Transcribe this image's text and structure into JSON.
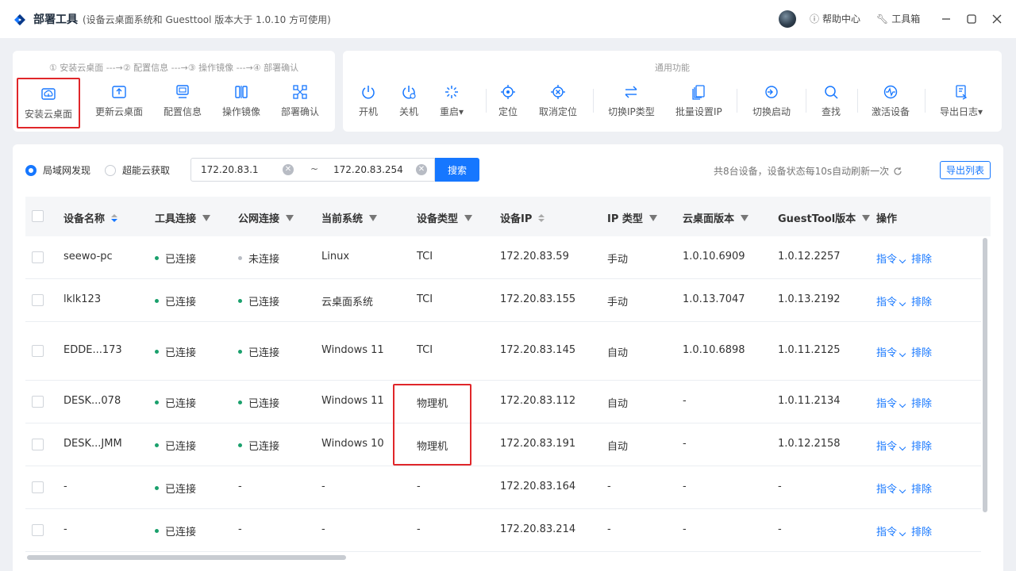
{
  "app": {
    "title": "部署工具",
    "subtitle": "(设备云桌面系统和 Guesttool 版本大于 1.0.10 方可使用)",
    "help_label": "帮助中心",
    "toolbox_label": "工具箱"
  },
  "steps": {
    "header": "① 安装云桌面 ---→② 配置信息 ---→③ 操作镜像 ---→④ 部署确认",
    "tools": [
      {
        "label": "安装云桌面",
        "icon": "cloud-upload-icon"
      },
      {
        "label": "更新云桌面",
        "icon": "upload-box-icon"
      },
      {
        "label": "配置信息",
        "icon": "monitor-config-icon"
      },
      {
        "label": "操作镜像",
        "icon": "mirror-icon"
      },
      {
        "label": "部署确认",
        "icon": "network-nodes-icon"
      }
    ]
  },
  "common": {
    "header": "通用功能",
    "tools": [
      {
        "label": "开机",
        "icon": "power-icon"
      },
      {
        "label": "关机",
        "icon": "power-off-icon"
      },
      {
        "label": "重启▾",
        "icon": "restart-icon"
      },
      {
        "label": "定位",
        "icon": "locate-icon"
      },
      {
        "label": "取消定位",
        "icon": "cancel-locate-icon"
      },
      {
        "label": "切换IP类型",
        "icon": "switch-arrows-icon"
      },
      {
        "label": "批量设置IP",
        "icon": "batch-ip-icon"
      },
      {
        "label": "切换启动",
        "icon": "switch-boot-icon"
      },
      {
        "label": "查找",
        "icon": "search-icon"
      },
      {
        "label": "激活设备",
        "icon": "activate-icon"
      },
      {
        "label": "导出日志▾",
        "icon": "export-log-icon"
      }
    ]
  },
  "filters": {
    "radio_lan": "局域网发现",
    "radio_cloud": "超能云获取",
    "ip_start": "172.20.83.1",
    "ip_sep": "~",
    "ip_end": "172.20.83.254",
    "search_label": "搜索",
    "summary": "共8台设备，设备状态每10s自动刷新一次",
    "export_list": "导出列表"
  },
  "table": {
    "headers": [
      "设备名称",
      "工具连接",
      "公网连接",
      "当前系统",
      "设备类型",
      "设备IP",
      "IP 类型",
      "云桌面版本",
      "GuestTool版本",
      "操作"
    ],
    "action_cmd": "指令",
    "action_remove": "排除",
    "rows": [
      {
        "name": "seewo-pc",
        "tool": "已连接",
        "tool_on": true,
        "net": "未连接",
        "net_on": false,
        "os": "Linux",
        "type": "TCI",
        "ip": "172.20.83.59",
        "iptype": "手动",
        "cloud_ver": "1.0.10.6909",
        "guest_ver": "1.0.12.2257"
      },
      {
        "name": "lklk123",
        "tool": "已连接",
        "tool_on": true,
        "net": "已连接",
        "net_on": true,
        "os": "云桌面系统",
        "type": "TCI",
        "ip": "172.20.83.155",
        "iptype": "手动",
        "cloud_ver": "1.0.13.7047",
        "guest_ver": "1.0.13.2192"
      },
      {
        "name": "EDDE...173",
        "tool": "已连接",
        "tool_on": true,
        "net": "已连接",
        "net_on": true,
        "os": "Windows 11",
        "type": "TCI",
        "ip": "172.20.83.145",
        "iptype": "自动",
        "cloud_ver": "1.0.10.6898",
        "guest_ver": "1.0.11.2125"
      },
      {
        "name": "DESK...078",
        "tool": "已连接",
        "tool_on": true,
        "net": "已连接",
        "net_on": true,
        "os": "Windows 11",
        "type": "物理机",
        "ip": "172.20.83.112",
        "iptype": "自动",
        "cloud_ver": "-",
        "guest_ver": "1.0.11.2134"
      },
      {
        "name": "DESK...JMM",
        "tool": "已连接",
        "tool_on": true,
        "net": "已连接",
        "net_on": true,
        "os": "Windows 10",
        "type": "物理机",
        "ip": "172.20.83.191",
        "iptype": "自动",
        "cloud_ver": "-",
        "guest_ver": "1.0.12.2158"
      },
      {
        "name": "-",
        "tool": "已连接",
        "tool_on": true,
        "net": "-",
        "net_on": null,
        "os": "-",
        "type": "-",
        "ip": "172.20.83.164",
        "iptype": "-",
        "cloud_ver": "-",
        "guest_ver": "-"
      },
      {
        "name": "-",
        "tool": "已连接",
        "tool_on": true,
        "net": "-",
        "net_on": null,
        "os": "-",
        "type": "-",
        "ip": "172.20.83.214",
        "iptype": "-",
        "cloud_ver": "-",
        "guest_ver": "-"
      }
    ]
  },
  "colors": {
    "accent": "#1677ff",
    "highlight": "#e0262a",
    "online": "#1aa06c",
    "offline": "#b8bcc4"
  }
}
